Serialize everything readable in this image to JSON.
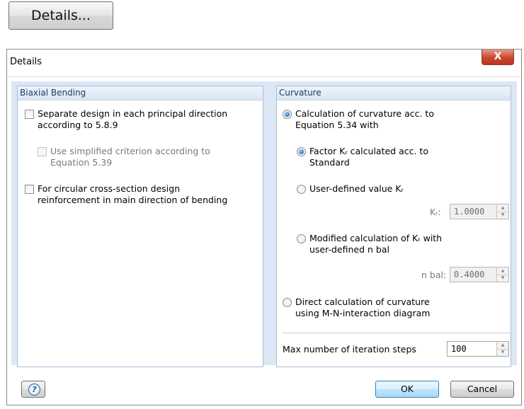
{
  "top_button": {
    "label": "Details..."
  },
  "dialog": {
    "title": "Details",
    "close_glyph": "X",
    "biaxial": {
      "title": "Biaxial Bending",
      "separate_design": {
        "line1": "Separate design in each principal direction",
        "line2": "according to 5.8.9",
        "checked": false
      },
      "simplified": {
        "line1": "Use simplified criterion according to",
        "line2": "Equation 5.39",
        "checked": false,
        "enabled": false
      },
      "circular": {
        "line1": "For circular cross-section design",
        "line2": "reinforcement in main direction of bending",
        "checked": false
      }
    },
    "curvature": {
      "title": "Curvature",
      "calc_eq": {
        "line1": "Calculation of curvature acc. to",
        "line2": "Equation 5.34 with",
        "selected": true
      },
      "factor_kr": {
        "line1": "Factor Kᵣ calculated acc. to",
        "line2": "Standard",
        "selected": true
      },
      "user_kr": {
        "label": "User-defined value Kᵣ",
        "selected": false
      },
      "kr_field": {
        "label": "Kᵣ:",
        "value": "1.0000"
      },
      "modified": {
        "line1": "Modified calculation of Kᵣ with",
        "line2": "user-defined n bal",
        "selected": false
      },
      "nbal_field": {
        "label": "n bal:",
        "value": "0.4000"
      },
      "direct": {
        "line1": "Direct calculation of curvature",
        "line2": "using M-N-interaction diagram",
        "selected": false
      },
      "max_iter": {
        "label": "Max number of iteration steps",
        "value": "100"
      }
    },
    "buttons": {
      "ok": "OK",
      "cancel": "Cancel",
      "help_glyph": "?"
    }
  }
}
